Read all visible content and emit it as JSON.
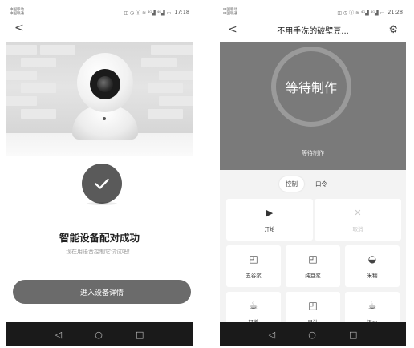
{
  "left": {
    "status": {
      "carrier1": "中国移动",
      "carrier2": "中国联通",
      "icons": "◫ ◷ ⓝ ≋ ⁴ᴳ▟ ⁴ᴳ▟ ▭",
      "time": "17:18"
    },
    "nav_back": "<",
    "success_title": "智能设备配对成功",
    "success_subtitle": "现在用语音控制它试试吧！",
    "detail_button": "进入设备详情"
  },
  "right": {
    "status": {
      "carrier1": "中国移动",
      "carrier2": "中国联通",
      "icons": "◫ ◷ ⓝ ≋ ⁴ᴳ▟ ⁴ᴳ▟ ▭",
      "time": "21:28"
    },
    "nav_back": "<",
    "title": "不用手洗的破壁豆...",
    "settings_icon": "⚙",
    "ring_label": "等待制作",
    "hero_sub": "等待制作",
    "segments": [
      "控制",
      "口令"
    ],
    "actions": {
      "start": "开始",
      "cancel": "取消",
      "start_icon": "▶",
      "cancel_icon": "✕"
    },
    "tiles": [
      {
        "icon": "◰",
        "label": "五谷浆"
      },
      {
        "icon": "◰",
        "label": "纯豆浆"
      },
      {
        "icon": "◒",
        "label": "米糊"
      },
      {
        "icon": "☕",
        "label": "轻养"
      },
      {
        "icon": "◰",
        "label": "果汁"
      },
      {
        "icon": "☕",
        "label": "温水"
      }
    ]
  },
  "navbar": {
    "back": "◁",
    "home": "○",
    "recent": "□"
  },
  "colors": {
    "button_gray": "#6b6b6b",
    "hero_gray": "#7a7a7a",
    "nav_black": "#1a1a1a"
  }
}
